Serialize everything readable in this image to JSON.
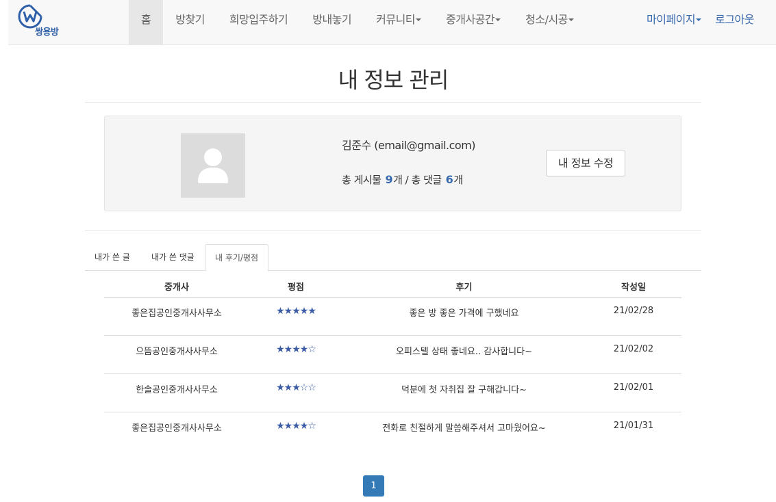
{
  "brand": {
    "name": "쌍용방",
    "color": "#2e5fa8"
  },
  "nav": {
    "items": [
      {
        "label": "홈",
        "active": true,
        "dropdown": false
      },
      {
        "label": "방찾기",
        "active": false,
        "dropdown": false
      },
      {
        "label": "희망입주하기",
        "active": false,
        "dropdown": false
      },
      {
        "label": "방내놓기",
        "active": false,
        "dropdown": false
      },
      {
        "label": "커뮤니티",
        "active": false,
        "dropdown": true
      },
      {
        "label": "중개사공간",
        "active": false,
        "dropdown": true
      },
      {
        "label": "청소/시공",
        "active": false,
        "dropdown": true
      }
    ],
    "right": [
      {
        "label": "마이페이지",
        "dropdown": true
      },
      {
        "label": "로그아웃",
        "dropdown": false
      }
    ]
  },
  "page": {
    "title": "내 정보 관리"
  },
  "profile": {
    "name_line": "김준수 (email@gmail.com)",
    "stats": {
      "posts_prefix": "총 게시물",
      "posts_count": "9",
      "posts_suffix": "개 / 총 댓글",
      "comments_count": "6",
      "comments_suffix": "개"
    },
    "edit_button": "내 정보 수정"
  },
  "tabs": [
    {
      "label": "내가 쓴 글",
      "active": false
    },
    {
      "label": "내가 쓴 댓글",
      "active": false
    },
    {
      "label": "내 후기/평점",
      "active": true
    }
  ],
  "reviews": {
    "columns": [
      "중개사",
      "평점",
      "후기",
      "작성일"
    ],
    "rows": [
      {
        "agency": "좋은집공인중개사사무소",
        "rating": 5,
        "stars": "★★★★★",
        "review": "좋은 방 좋은 가격에 구했네요",
        "date": "21/02/28"
      },
      {
        "agency": "으뜸공인중개사사무소",
        "rating": 4,
        "stars": "★★★★☆",
        "review": "오피스텔 상태 좋네요.. 감사합니다~",
        "date": "21/02/02"
      },
      {
        "agency": "한솔공인중개사사무소",
        "rating": 3,
        "stars": "★★★☆☆",
        "review": "덕분에 첫 자취집 잘 구해갑니다~",
        "date": "21/02/01"
      },
      {
        "agency": "좋은집공인중개사사무소",
        "rating": 4,
        "stars": "★★★★☆",
        "review": "전화로 친절하게 말씀해주셔서 고마웠어요~",
        "date": "21/01/31"
      }
    ]
  },
  "pagination": {
    "current": "1"
  },
  "colors": {
    "accent": "#3a6aae",
    "star": "#3b5ba5",
    "pager": "#337ab7"
  }
}
